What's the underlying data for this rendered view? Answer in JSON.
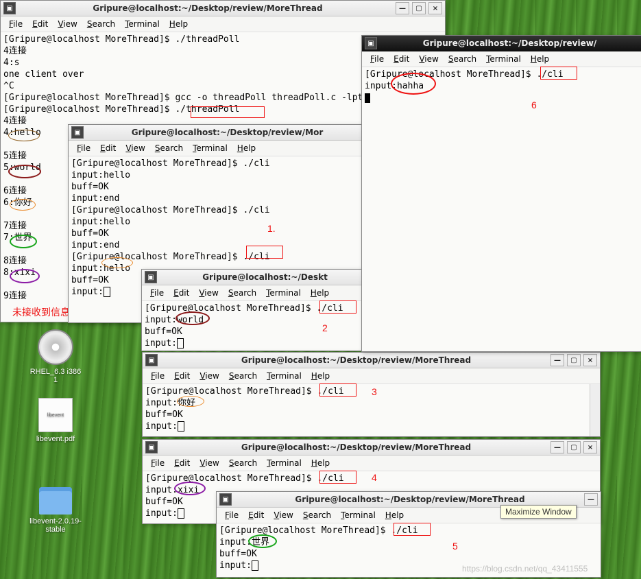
{
  "menus": {
    "file": "File",
    "edit": "Edit",
    "view": "View",
    "search": "Search",
    "terminal": "Terminal",
    "help": "Help"
  },
  "windows": {
    "main": {
      "title": "Gripure@localhost:~/Desktop/review/MoreThread",
      "body": "[Gripure@localhost MoreThread]$ ./threadPoll\n4连接\n4:s\none client over\n^C\n[Gripure@localhost MoreThread]$ gcc -o threadPoll threadPoll.c -lpthread\n[Gripure@localhost MoreThread]$ ./threadPoll\n4连接\n4:hello\n\n5连接\n5:world\n\n6连接\n6:你好\n\n7连接\n7:世界\n\n8连接\n8:xixi\n\n9连接"
    },
    "t1": {
      "title": "Gripure@localhost:~/Desktop/review/Mor",
      "body": "[Gripure@localhost MoreThread]$ ./cli\ninput:hello\nbuff=OK\ninput:end\n[Gripure@localhost MoreThread]$ ./cli\ninput:hello\nbuff=OK\ninput:end\n[Gripure@localhost MoreThread]$ ./cli\ninput:hello\nbuff=OK\ninput:"
    },
    "t2": {
      "title": "Gripure@localhost:~/Deskt",
      "body": "[Gripure@localhost MoreThread]$ ./cli\ninput:world\nbuff=OK\ninput:"
    },
    "t3": {
      "title": "Gripure@localhost:~/Desktop/review/MoreThread",
      "body": "[Gripure@localhost MoreThread]$ ./cli\ninput:你好\nbuff=OK\ninput:"
    },
    "t4": {
      "title": "Gripure@localhost:~/Desktop/review/MoreThread",
      "body": "[Gripure@localhost MoreThread]$ ./cli\ninput:xixi\nbuff=OK\ninput:"
    },
    "t5": {
      "title": "Gripure@localhost:~/Desktop/review/MoreThread",
      "body": "[Gripure@localhost MoreThread]$ ./cli\ninput:世界\nbuff=OK\ninput:"
    },
    "t6": {
      "title": "Gripure@localhost:~/Desktop/review/",
      "body": "[Gripure@localhost MoreThread]$ ./cli\ninput:hahha\n"
    }
  },
  "annotations": {
    "no_msg": "未接收到信息。",
    "n1": "1.",
    "n2": "2",
    "n3": "3",
    "n4": "4",
    "n5": "5",
    "n6": "6"
  },
  "desktop_icons": {
    "dvd": "RHEL_6.3 i386\n1",
    "pdf": "libevent.pdf",
    "folder": "libevent-2.0.19-stable"
  },
  "tooltip": "Maximize Window",
  "watermark": "https://blog.csdn.net/qq_43411555"
}
